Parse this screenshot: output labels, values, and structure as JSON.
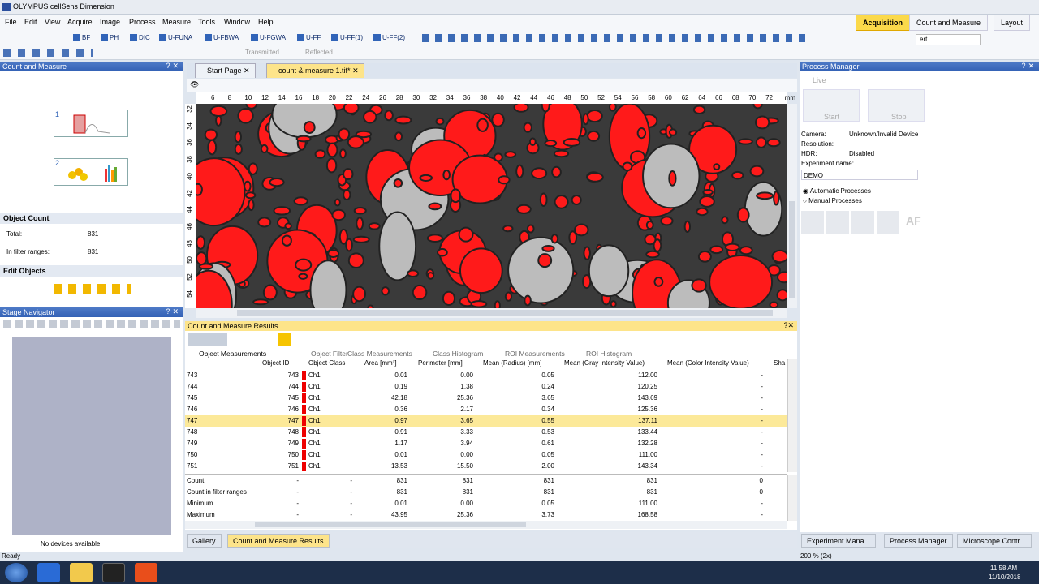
{
  "app_title": "OLYMPUS cellSens Dimension",
  "menu": [
    "File",
    "Edit",
    "View",
    "Acquire",
    "Image",
    "Process",
    "Measure",
    "Tools",
    "Window",
    "Help"
  ],
  "ribbon_tabs": [
    "Acquisition",
    "Count and Measure",
    "Layout"
  ],
  "toolbar_buttons": [
    "BF",
    "PH",
    "DIC",
    "U-FUNA",
    "U-FBWA",
    "U-FGWA",
    "U-FF",
    "U-FF(1)",
    "U-FF(2)"
  ],
  "toolbar_transmitted": "Transmitted",
  "toolbar_reflected": "Reflected",
  "toolbar_search": "ert",
  "left_panel": {
    "title": "Count and Measure",
    "step1": "1",
    "step2": "2",
    "object_count_title": "Object Count",
    "total_label": "Total:",
    "total_value": "831",
    "filter_label": "In filter ranges:",
    "filter_value": "831",
    "edit_objects_title": "Edit Objects"
  },
  "stage_navigator": {
    "title": "Stage Navigator",
    "status": "No devices available"
  },
  "doc_tabs": [
    "Start Page",
    "count & measure 1.tif*"
  ],
  "ruler_unit": "mm",
  "ruler_h": [
    "6",
    "8",
    "10",
    "12",
    "14",
    "16",
    "18",
    "20",
    "22",
    "24",
    "26",
    "28",
    "30",
    "32",
    "34",
    "36",
    "38",
    "40",
    "42",
    "44",
    "46",
    "48",
    "50",
    "52",
    "54",
    "56",
    "58",
    "60",
    "62",
    "64",
    "66",
    "68",
    "70",
    "72"
  ],
  "ruler_v": [
    "32",
    "34",
    "36",
    "38",
    "40",
    "42",
    "44",
    "46",
    "48",
    "50",
    "52",
    "54"
  ],
  "results": {
    "title": "Count and Measure Results",
    "subtabs": [
      "Object Measurements",
      "Object Filter",
      "Class Measurements",
      "Class Histogram",
      "ROI Measurements",
      "ROI Histogram"
    ],
    "columns": [
      "Object ID",
      "Object Class",
      "Area [mm²]",
      "Perimeter [mm]",
      "Mean (Radius) [mm]",
      "Mean (Gray Intensity Value)",
      "Mean (Color Intensity Value)",
      "Sha"
    ],
    "rows": [
      {
        "idx": "743",
        "id": "743",
        "cls": "Ch1",
        "area": "0.01",
        "per": "0.00",
        "rad": "0.05",
        "gray": "112.00",
        "color": "-"
      },
      {
        "idx": "744",
        "id": "744",
        "cls": "Ch1",
        "area": "0.19",
        "per": "1.38",
        "rad": "0.24",
        "gray": "120.25",
        "color": "-"
      },
      {
        "idx": "745",
        "id": "745",
        "cls": "Ch1",
        "area": "42.18",
        "per": "25.36",
        "rad": "3.65",
        "gray": "143.69",
        "color": "-"
      },
      {
        "idx": "746",
        "id": "746",
        "cls": "Ch1",
        "area": "0.36",
        "per": "2.17",
        "rad": "0.34",
        "gray": "125.36",
        "color": "-"
      },
      {
        "idx": "747",
        "id": "747",
        "cls": "Ch1",
        "area": "0.97",
        "per": "3.65",
        "rad": "0.55",
        "gray": "137.11",
        "color": "-"
      },
      {
        "idx": "748",
        "id": "748",
        "cls": "Ch1",
        "area": "0.91",
        "per": "3.33",
        "rad": "0.53",
        "gray": "133.44",
        "color": "-"
      },
      {
        "idx": "749",
        "id": "749",
        "cls": "Ch1",
        "area": "1.17",
        "per": "3.94",
        "rad": "0.61",
        "gray": "132.28",
        "color": "-"
      },
      {
        "idx": "750",
        "id": "750",
        "cls": "Ch1",
        "area": "0.01",
        "per": "0.00",
        "rad": "0.05",
        "gray": "111.00",
        "color": "-"
      },
      {
        "idx": "751",
        "id": "751",
        "cls": "Ch1",
        "area": "13.53",
        "per": "15.50",
        "rad": "2.00",
        "gray": "143.34",
        "color": "-"
      }
    ],
    "stats": [
      {
        "label": "Count",
        "id": "-",
        "cls": "-",
        "area": "831",
        "per": "831",
        "rad": "831",
        "gray": "831",
        "color": "0"
      },
      {
        "label": "Count in filter ranges",
        "id": "-",
        "cls": "-",
        "area": "831",
        "per": "831",
        "rad": "831",
        "gray": "831",
        "color": "0"
      },
      {
        "label": "Minimum",
        "id": "-",
        "cls": "-",
        "area": "0.01",
        "per": "0.00",
        "rad": "0.05",
        "gray": "111.00",
        "color": "-"
      },
      {
        "label": "Maximum",
        "id": "-",
        "cls": "-",
        "area": "43.95",
        "per": "25.36",
        "rad": "3.73",
        "gray": "168.58",
        "color": "-"
      }
    ]
  },
  "bottom_tabs": [
    "Gallery",
    "Count and Measure Results"
  ],
  "process_manager": {
    "title": "Process Manager",
    "live": "Live",
    "start": "Start",
    "stop": "Stop",
    "camera_label": "Camera:",
    "camera_value": "Unknown/Invalid Device",
    "resolution_label": "Resolution:",
    "hdr_label": "HDR:",
    "hdr_value": "Disabled",
    "experiment_label": "Experiment name:",
    "experiment_value": "DEMO",
    "auto": "Automatic Processes",
    "manual": "Manual Processes",
    "af": "AF"
  },
  "right_bottom_tabs": [
    "Experiment Mana...",
    "Process Manager",
    "Microscope Contr..."
  ],
  "status_ready": "Ready",
  "zoom": "200 % (2x)",
  "clock_time": "11:58 AM",
  "clock_date": "11/10/2018",
  "colors": {
    "accent": "#fde48a",
    "panel_blue": "#3361b5",
    "object_red": "#ff1a1a"
  }
}
